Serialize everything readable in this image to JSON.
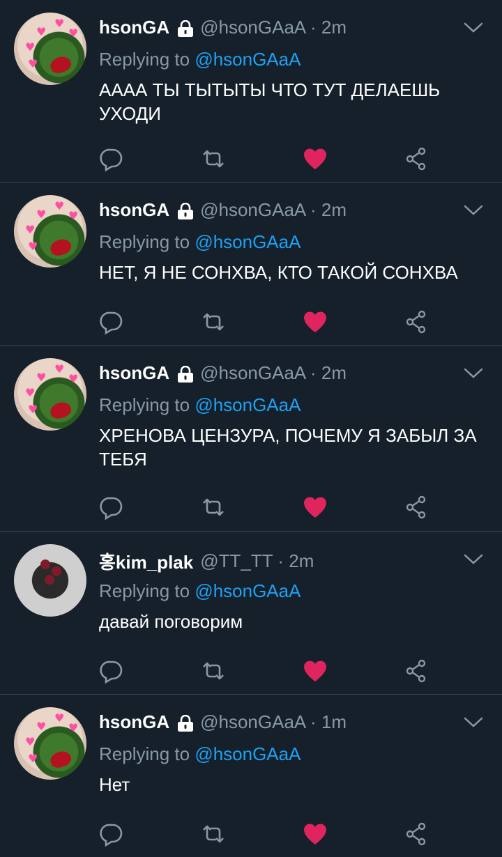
{
  "tweets": [
    {
      "name": "hsonGA",
      "locked": true,
      "handle_time": "@hsonGAaA · 2m",
      "replying_prefix": "Replying to",
      "replying_to": "@hsonGAaA",
      "text": "АААА ТЫ ТЫТЫТЫ ЧТО ТУТ ДЕЛАЕШЬ УХОДИ",
      "avatar": "frog",
      "liked": true
    },
    {
      "name": "hsonGA",
      "locked": true,
      "handle_time": "@hsonGAaA · 2m",
      "replying_prefix": "Replying to",
      "replying_to": "@hsonGAaA",
      "text": "НЕТ, Я НЕ СОНХВА, КТО ТАКОЙ СОНХВА",
      "avatar": "frog",
      "liked": true
    },
    {
      "name": "hsonGA",
      "locked": true,
      "handle_time": "@hsonGAaA · 2m",
      "replying_prefix": "Replying to",
      "replying_to": "@hsonGAaA",
      "text": "ХРЕНОВА ЦЕНЗУРА, ПОЧЕМУ Я ЗАБЫЛ ЗА ТЕБЯ",
      "avatar": "frog",
      "liked": true
    },
    {
      "name": "홍kim_plak",
      "locked": false,
      "handle_time": "@TT_TT · 2m",
      "replying_prefix": "Replying to",
      "replying_to": "@hsonGAaA",
      "text": "давай поговорим",
      "avatar": "bouquet",
      "liked": true
    },
    {
      "name": "hsonGA",
      "locked": true,
      "handle_time": "@hsonGAaA · 1m",
      "replying_prefix": "Replying to",
      "replying_to": "@hsonGAaA",
      "text": "Нет",
      "avatar": "frog",
      "liked": true
    }
  ],
  "icons": {
    "reply": "reply-icon",
    "retweet": "retweet-icon",
    "like": "heart-icon",
    "share": "share-icon",
    "more": "chevron-down-icon",
    "lock": "lock-icon"
  },
  "colors": {
    "background": "#15202b",
    "divider": "#38444d",
    "secondary_text": "#8899a6",
    "link": "#1da1f2",
    "like_active": "#e0245e"
  }
}
